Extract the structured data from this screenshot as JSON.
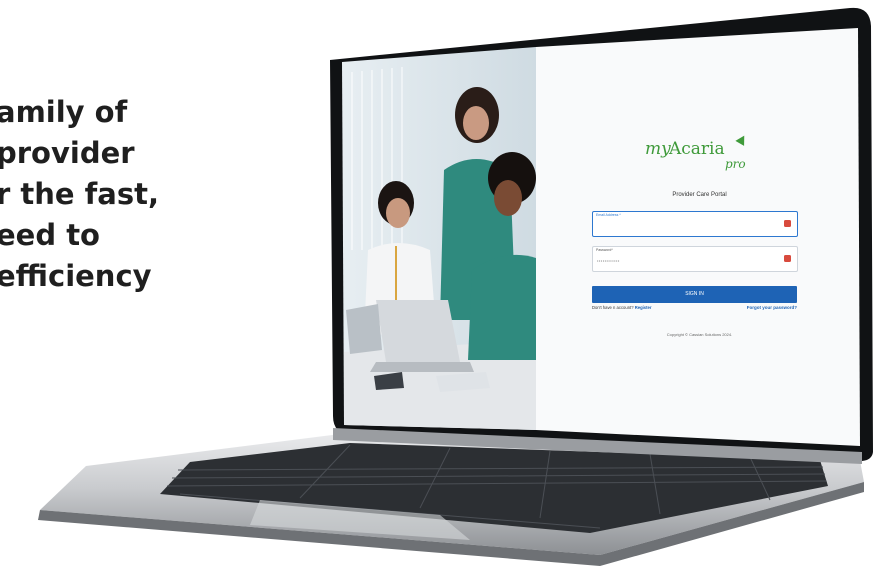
{
  "headline": {
    "lines": [
      "amily of",
      "provider",
      "r the fast,",
      "eed to",
      "efficiency"
    ]
  },
  "login": {
    "brand": {
      "my": "my",
      "acaria": "Acaria",
      "pro": "pro"
    },
    "portal_title": "Provider Care Portal",
    "email_label": "Email Address *",
    "email_value": "",
    "password_label": "Password*",
    "password_value": "••••••••••••",
    "signin_label": "SIGN IN",
    "no_account_text": "Don't have n account?",
    "register_label": "Register",
    "forgot_label": "Forgot your password?",
    "copyright": "Copyright © Cassian Solutions 2024."
  },
  "colors": {
    "brand_green": "#3f9a3a",
    "primary_blue": "#1e63b5",
    "field_error_icon": "#d84a3d"
  },
  "icons": [
    "field-error-icon",
    "password-visibility-icon"
  ]
}
